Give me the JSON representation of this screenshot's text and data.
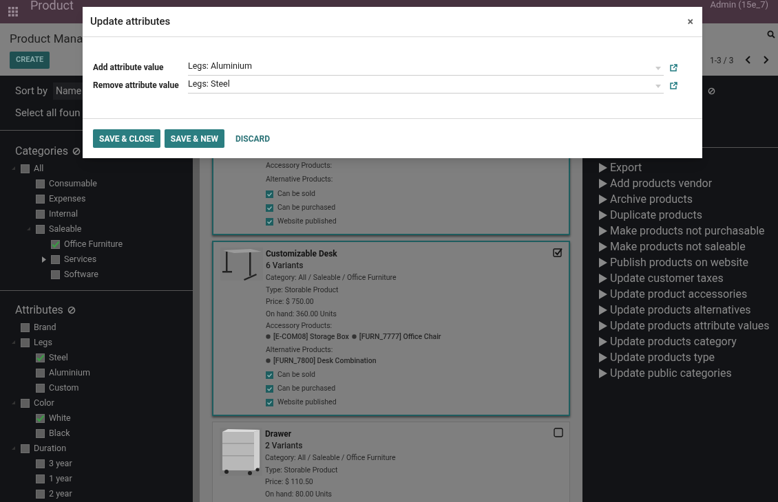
{
  "navbar": {
    "app_title": "Product",
    "user_name": "Admin (15e_7)"
  },
  "control_panel": {
    "breadcrumb": "Product Mana",
    "create_button": "CREATE",
    "pager": "1-3 / 3"
  },
  "sidebar": {
    "sort_label": "Sort by",
    "sort_value": "Name",
    "select_all": "Select all foun",
    "categories": {
      "title": "Categories",
      "items": [
        {
          "label": "All",
          "checked": false,
          "expanded": true,
          "children": [
            {
              "label": "Consumable",
              "checked": false
            },
            {
              "label": "Expenses",
              "checked": false
            },
            {
              "label": "Internal",
              "checked": false
            },
            {
              "label": "Saleable",
              "checked": false,
              "expanded": true,
              "children": [
                {
                  "label": "Office Furniture",
                  "checked": true
                },
                {
                  "label": "Services",
                  "checked": false,
                  "expanded": false
                },
                {
                  "label": "Software",
                  "checked": false
                }
              ]
            }
          ]
        }
      ]
    },
    "attributes": {
      "title": "Attributes",
      "items": [
        {
          "label": "Brand",
          "checked": false
        },
        {
          "label": "Legs",
          "checked": false,
          "expanded": true,
          "children": [
            {
              "label": "Steel",
              "checked": true
            },
            {
              "label": "Aluminium",
              "checked": false
            },
            {
              "label": "Custom",
              "checked": false
            }
          ]
        },
        {
          "label": "Color",
          "checked": false,
          "expanded": true,
          "children": [
            {
              "label": "White",
              "checked": true
            },
            {
              "label": "Black",
              "checked": false
            }
          ]
        },
        {
          "label": "Duration",
          "checked": false,
          "expanded": true,
          "children": [
            {
              "label": "3 year",
              "checked": false
            },
            {
              "label": "1 year",
              "checked": false
            },
            {
              "label": "2 year",
              "checked": false
            }
          ]
        }
      ]
    }
  },
  "cards": [
    {
      "selected": true,
      "accessory": {
        "label": "Accessory Products:"
      },
      "alternative": {
        "label": "Alternative Products:"
      },
      "flags": [
        {
          "label": "Can be sold",
          "checked": true
        },
        {
          "label": "Can be purchased",
          "checked": true
        },
        {
          "label": "Website published",
          "checked": true
        }
      ]
    },
    {
      "selected": true,
      "image": {
        "kind": "picture"
      },
      "name": "Customizable Desk",
      "variants": "6 Variants",
      "lines": [
        "Category: All / Saleable / Office Furniture",
        "Type: Storable Product",
        "Price: $ 750.00",
        "On hand: 360.00 Units"
      ],
      "accessory": {
        "label": "Accessory Products:",
        "items": [
          "[E-COM08] Storage Box",
          "[FURN_7777] Office Chair"
        ]
      },
      "alternative": {
        "label": "Alternative Products:",
        "items": [
          "[FURN_7800] Desk Combination"
        ]
      },
      "flags": [
        {
          "label": "Can be sold",
          "checked": true
        },
        {
          "label": "Can be purchased",
          "checked": true
        },
        {
          "label": "Website published",
          "checked": true
        }
      ]
    },
    {
      "selected": false,
      "image": {
        "kind": "picture"
      },
      "name": "Drawer",
      "variants": "2 Variants",
      "lines": [
        "Category: All / Saleable / Office Furniture",
        "Type: Storable Product",
        "Price: $ 110.50",
        "On hand: 80.00 Units"
      ]
    }
  ],
  "actions": [
    "Export",
    "Add products vendor",
    "Archive products",
    "Duplicate products",
    "Make products not purchasable",
    "Make products not saleable",
    "Publish products on website",
    "Update customer taxes",
    "Update product accessories",
    "Update products alternatives",
    "Update products attribute values",
    "Update products category",
    "Update products type",
    "Update public categories"
  ],
  "dialog": {
    "title": "Update attributes",
    "close": "×",
    "fields": [
      {
        "label": "Add attribute value",
        "value": "Legs: Aluminium"
      },
      {
        "label": "Remove attribute value",
        "value": "Legs: Steel"
      }
    ],
    "buttons": [
      {
        "label": "SAVE & CLOSE",
        "kind": "primary"
      },
      {
        "label": "SAVE & NEW",
        "kind": "primary"
      },
      {
        "label": "DISCARD",
        "kind": "link"
      }
    ]
  }
}
